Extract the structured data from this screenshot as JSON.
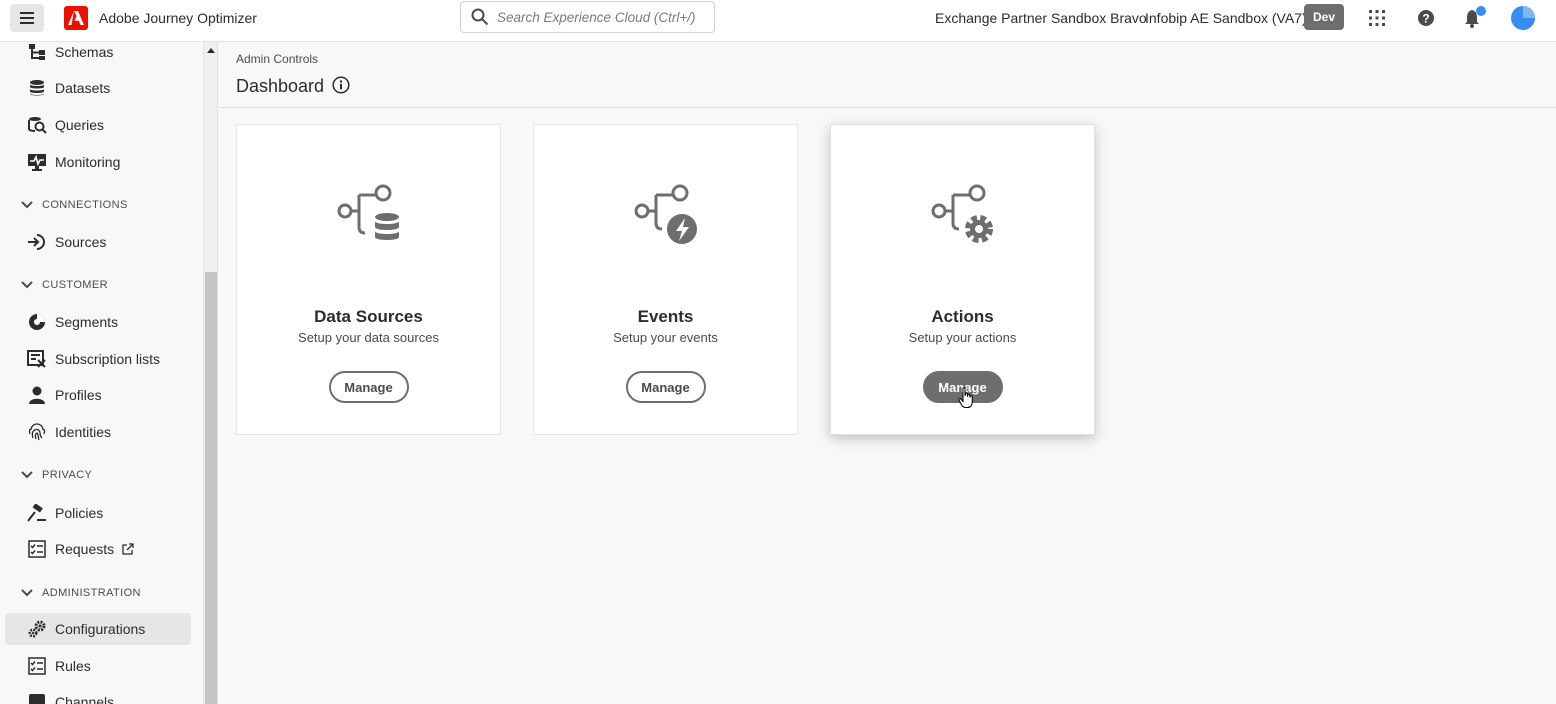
{
  "topbar": {
    "app_title": "Adobe Journey Optimizer",
    "search_placeholder": "Search Experience Cloud (Ctrl+/)",
    "org_name": "Exchange Partner Sandbox Bravo",
    "sandbox_name": "Infobip AE Sandbox (VA7)",
    "env_badge": "Dev"
  },
  "sidebar": {
    "items_top": [
      {
        "label": "Schemas",
        "icon": "schema-icon"
      },
      {
        "label": "Datasets",
        "icon": "database-icon"
      },
      {
        "label": "Queries",
        "icon": "query-icon"
      },
      {
        "label": "Monitoring",
        "icon": "monitoring-icon"
      }
    ],
    "sections": [
      {
        "label": "CONNECTIONS",
        "items": [
          {
            "label": "Sources",
            "icon": "sources-icon"
          }
        ]
      },
      {
        "label": "CUSTOMER",
        "items": [
          {
            "label": "Segments",
            "icon": "segments-icon"
          },
          {
            "label": "Subscription lists",
            "icon": "subscription-icon"
          },
          {
            "label": "Profiles",
            "icon": "profile-icon"
          },
          {
            "label": "Identities",
            "icon": "fingerprint-icon"
          }
        ]
      },
      {
        "label": "PRIVACY",
        "items": [
          {
            "label": "Policies",
            "icon": "policies-icon"
          },
          {
            "label": "Requests",
            "icon": "requests-icon"
          }
        ]
      },
      {
        "label": "ADMINISTRATION",
        "items": [
          {
            "label": "Configurations",
            "icon": "gears-icon",
            "active": true
          },
          {
            "label": "Rules",
            "icon": "rules-icon"
          },
          {
            "label": "Channels",
            "icon": "channels-icon"
          }
        ]
      }
    ]
  },
  "main": {
    "breadcrumb": "Admin Controls",
    "title": "Dashboard",
    "cards": [
      {
        "title": "Data Sources",
        "description": "Setup your data sources",
        "button": "Manage"
      },
      {
        "title": "Events",
        "description": "Setup your events",
        "button": "Manage"
      },
      {
        "title": "Actions",
        "description": "Setup your actions",
        "button": "Manage"
      }
    ]
  },
  "colors": {
    "brand": "#eb1000",
    "accent_blue": "#378ef0",
    "button_gray": "#6e6e6e"
  }
}
